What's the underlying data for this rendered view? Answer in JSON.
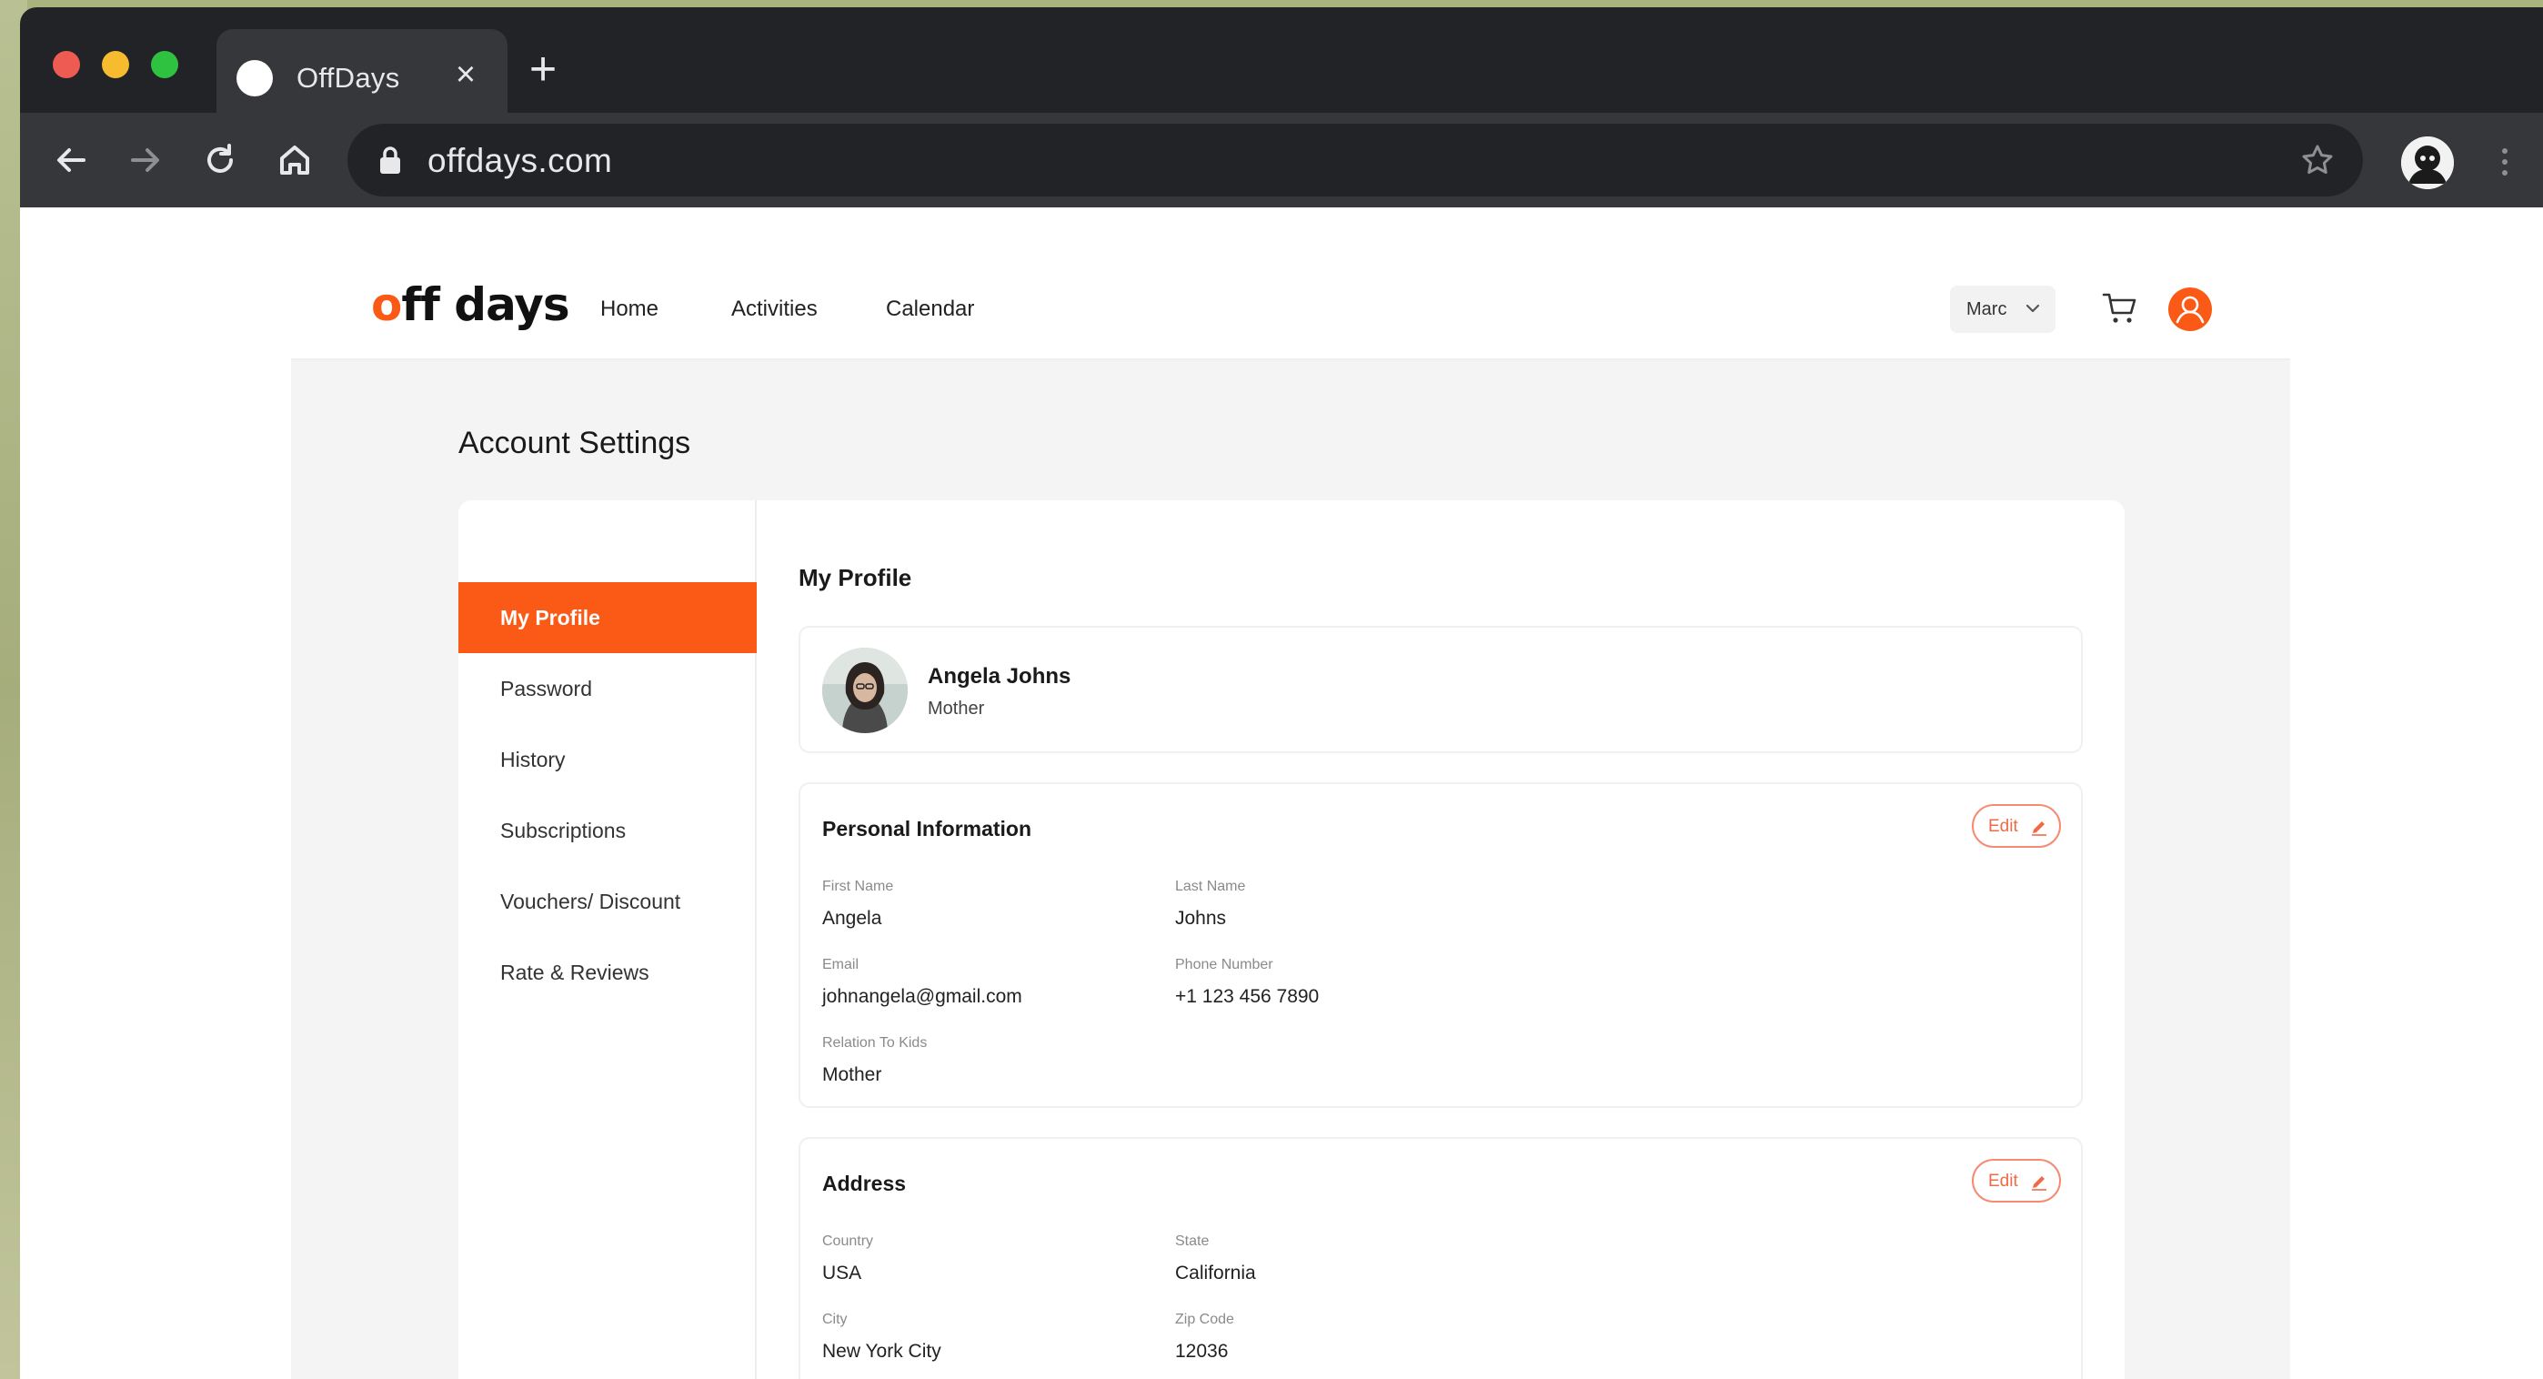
{
  "browser": {
    "tab_title": "OffDays",
    "url": "offdays.com"
  },
  "site": {
    "logo": {
      "o": "o",
      "rest": "ff days"
    },
    "nav": [
      "Home",
      "Activities",
      "Calendar"
    ],
    "user_select": "Marc",
    "accent_color": "#fa5a16"
  },
  "page": {
    "title": "Account Settings",
    "sidebar": [
      "My Profile",
      "Password",
      "History",
      "Subscriptions",
      "Vouchers/ Discount",
      "Rate & Reviews"
    ],
    "active_item": "My Profile"
  },
  "profile": {
    "section_title": "My Profile",
    "name": "Angela Johns",
    "role": "Mother"
  },
  "personal": {
    "title": "Personal Information",
    "edit_label": "Edit",
    "first_name_label": "First Name",
    "first_name": "Angela",
    "last_name_label": "Last Name",
    "last_name": "Johns",
    "email_label": "Email",
    "email": "johnangela@gmail.com",
    "phone_label": "Phone Number",
    "phone": "+1 123 456 7890",
    "relation_label": "Relation To Kids",
    "relation": "Mother"
  },
  "address": {
    "title": "Address",
    "edit_label": "Edit",
    "country_label": "Country",
    "country": "USA",
    "state_label": "State",
    "state": "California",
    "city_label": "City",
    "city": "New York City",
    "zip_label": "Zip Code",
    "zip": "12036"
  }
}
